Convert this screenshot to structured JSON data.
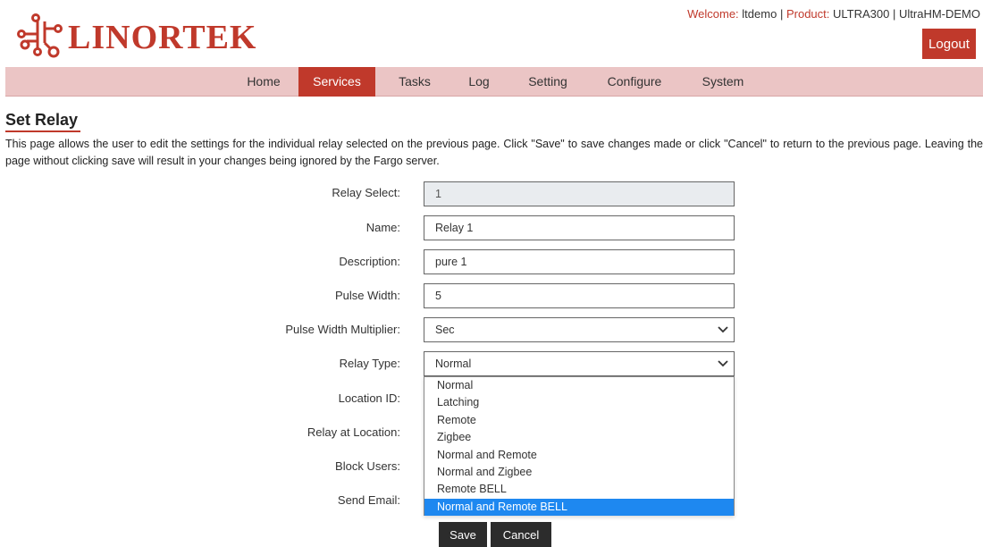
{
  "header": {
    "logo_text": "LINORTEK",
    "welcome_label": "Welcome:",
    "username": "ltdemo",
    "separator": "|",
    "product_label": "Product:",
    "product_name": "ULTRA300",
    "device_name": "UltraHM-DEMO",
    "logout_label": "Logout"
  },
  "nav": {
    "items": [
      {
        "label": "Home"
      },
      {
        "label": "Services"
      },
      {
        "label": "Tasks"
      },
      {
        "label": "Log"
      },
      {
        "label": "Setting"
      },
      {
        "label": "Configure"
      },
      {
        "label": "System"
      }
    ],
    "active": "Services"
  },
  "page": {
    "title": "Set Relay",
    "description": "This page allows the user to edit the settings for the individual relay selected on the previous page. Click \"Save\" to save changes made or click \"Cancel\" to return to the previous page. Leaving the page without clicking save will result in your changes being ignored by the Fargo server."
  },
  "form": {
    "relay_select": {
      "label": "Relay Select:",
      "value": "1"
    },
    "name": {
      "label": "Name:",
      "value": "Relay 1"
    },
    "description": {
      "label": "Description:",
      "value": "pure 1"
    },
    "pulse_width": {
      "label": "Pulse Width:",
      "value": "5"
    },
    "pulse_width_multiplier": {
      "label": "Pulse Width Multiplier:",
      "value": "Sec"
    },
    "relay_type": {
      "label": "Relay Type:",
      "value": "Normal",
      "options": [
        "Normal",
        "Latching",
        "Remote",
        "Zigbee",
        "Normal and Remote",
        "Normal and Zigbee",
        "Remote BELL",
        "Normal and Remote BELL"
      ],
      "highlighted": "Normal and Remote BELL"
    },
    "location_id": {
      "label": "Location ID:"
    },
    "relay_at_location": {
      "label": "Relay at Location:"
    },
    "block_users": {
      "label": "Block Users:"
    },
    "send_email": {
      "label": "Send Email:"
    }
  },
  "buttons": {
    "save": "Save",
    "cancel": "Cancel"
  },
  "colors": {
    "brand_red": "#c0392b",
    "nav_bg": "#ebc5c5",
    "highlight_blue": "#1e88f0",
    "button_dark": "#2c2c2c"
  }
}
